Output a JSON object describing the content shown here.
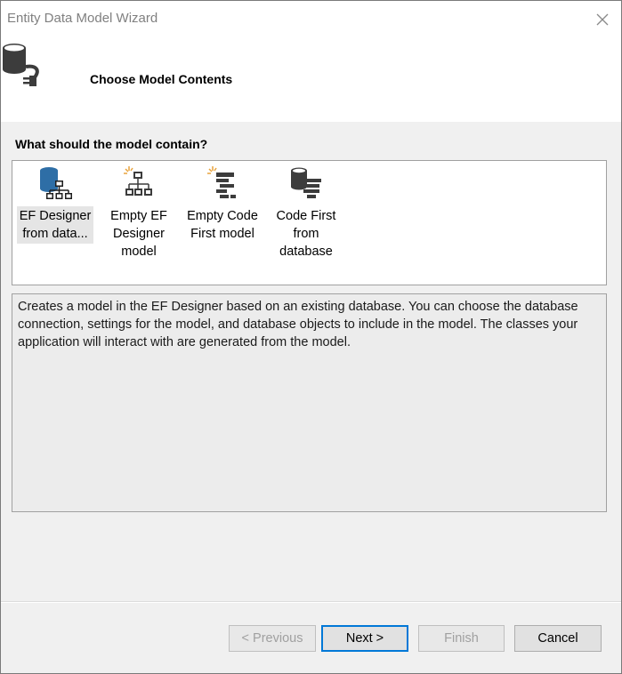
{
  "window": {
    "title": "Entity Data Model Wizard"
  },
  "header": {
    "title": "Choose Model Contents"
  },
  "question": "What should the model contain?",
  "choices": [
    {
      "label": "EF Designer from data...",
      "icon": "ef-designer-database-icon",
      "selected": true
    },
    {
      "label": "Empty EF Designer model",
      "icon": "empty-ef-designer-icon",
      "selected": false
    },
    {
      "label": "Empty Code First model",
      "icon": "empty-code-first-icon",
      "selected": false
    },
    {
      "label": "Code First from database",
      "icon": "code-first-database-icon",
      "selected": false
    }
  ],
  "description": "Creates a model in the EF Designer based on an existing database. You can choose the database connection, settings for the model, and database objects to include in the model. The classes your application will interact with are generated from the model.",
  "buttons": {
    "previous": "< Previous",
    "next": "Next >",
    "finish": "Finish",
    "cancel": "Cancel"
  },
  "colors": {
    "accent": "#0078d7",
    "icon_blue": "#2e6ea6",
    "icon_dark": "#3c3c3c",
    "spark": "#e8a33d"
  }
}
